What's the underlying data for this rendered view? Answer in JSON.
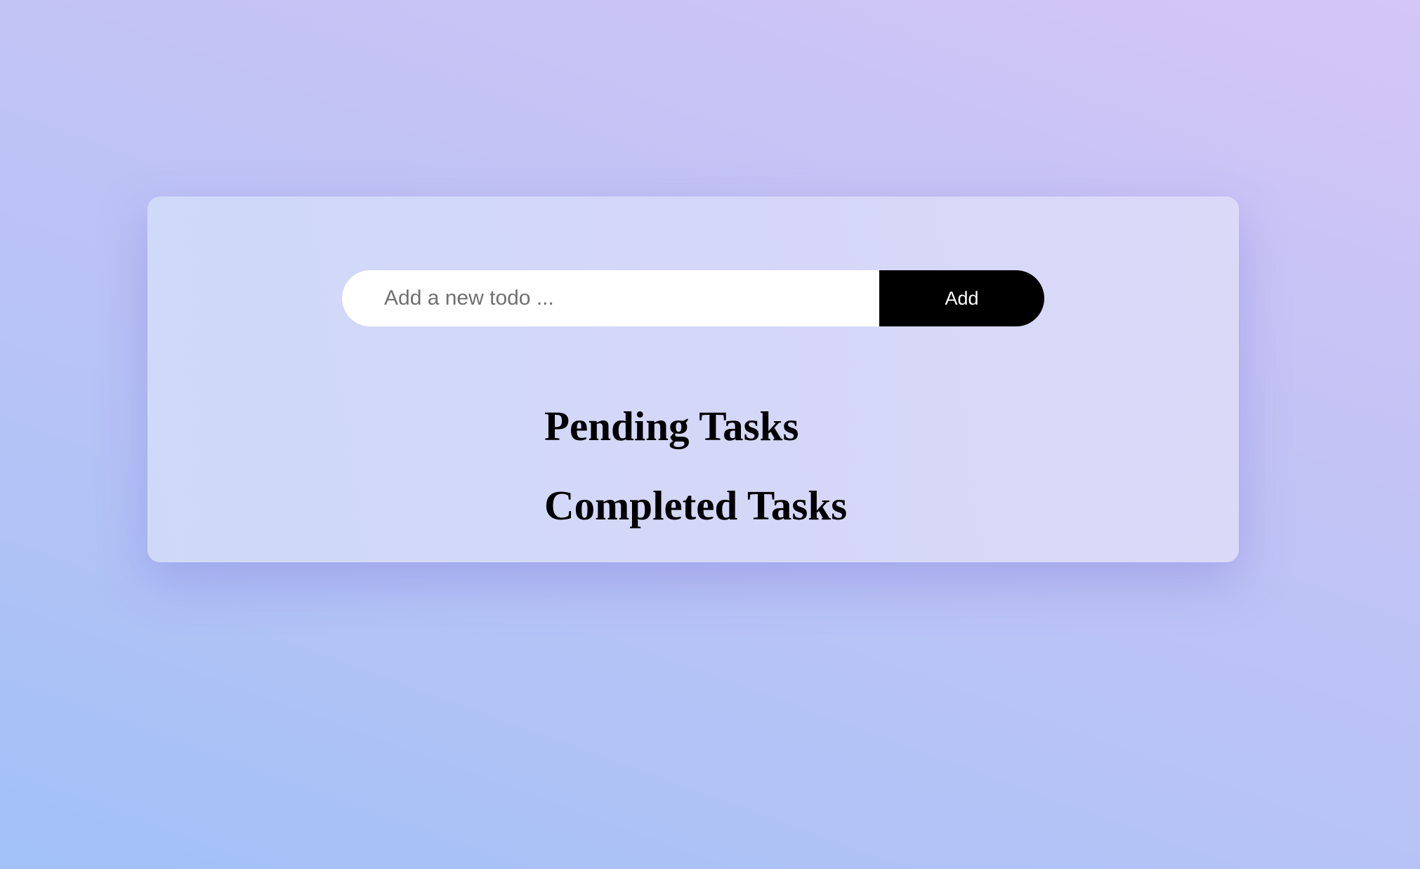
{
  "todo_form": {
    "input_value": "",
    "input_placeholder": "Add a new todo ...",
    "add_label": "Add"
  },
  "sections": {
    "pending_title": "Pending Tasks",
    "pending_items": [],
    "completed_title": "Completed Tasks",
    "completed_items": []
  },
  "colors": {
    "button_background": "#000000",
    "button_text": "#ffffff",
    "input_background": "#ffffff",
    "card_background": "#d3daf7"
  }
}
